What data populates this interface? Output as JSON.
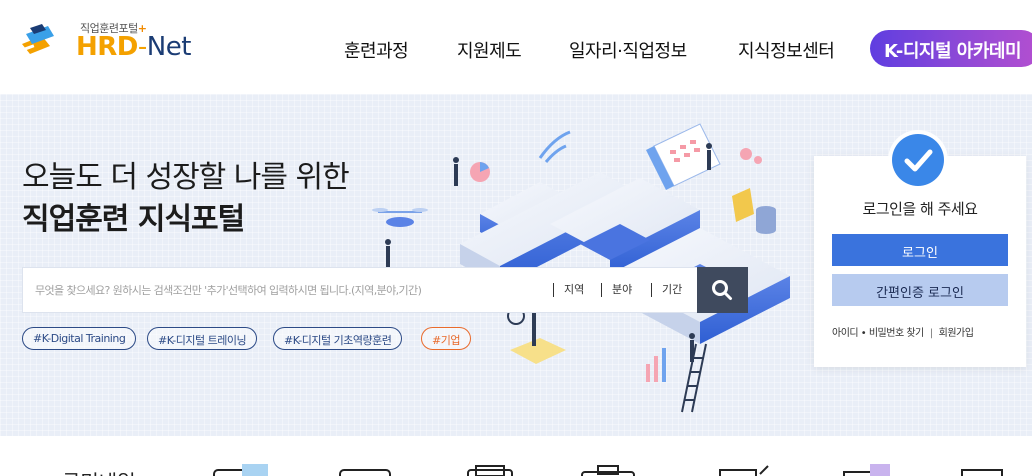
{
  "header": {
    "logo": {
      "subtitle": "직업훈련포털",
      "plus": "+",
      "brand_main": "HRD",
      "brand_dash": "-",
      "brand_net": "Net"
    },
    "nav": [
      {
        "label": "훈련과정"
      },
      {
        "label": "지원제도"
      },
      {
        "label": "일자리·직업정보"
      },
      {
        "label": "지식정보센터"
      }
    ],
    "academy_label": "K-디지털 아카데미"
  },
  "hero": {
    "headline_line1": "오늘도 더 성장할 나를 위한",
    "headline_line2": "직업훈련 지식포털",
    "search": {
      "placeholder": "무엇을 찾으세요? 원하시는 검색조건만 '추가'선택하여 입력하시면 됩니다.(지역,분야,기간)",
      "filters": [
        "지역",
        "분야",
        "기간"
      ]
    },
    "tags": [
      "#K-Digital Training",
      "#K-디지털 트레이닝",
      "#K-디지털 기초역량훈련",
      "#기업"
    ]
  },
  "login": {
    "title": "로그인을 해 주세요",
    "login_button": "로그인",
    "easy_login_button": "간편인증 로그인",
    "find_account": "아이디 • 비밀번호 찾기",
    "separator": "|",
    "signup": "회원가입"
  },
  "quick_menu": {
    "title": "국민내일"
  },
  "colors": {
    "brand_orange": "#f4a100",
    "brand_navy": "#1b3c74",
    "login_blue": "#3a73dd",
    "easy_login_blue": "#b7cbef",
    "tag_navy": "#2c4a86",
    "tag_orange": "#e96b2c",
    "search_button": "#3f4a5e",
    "hero_bg": "#e9eef7"
  },
  "icons": {
    "logo": "hrd-net-logo-icon",
    "search": "magnifier-icon",
    "check": "check-circle-icon"
  }
}
